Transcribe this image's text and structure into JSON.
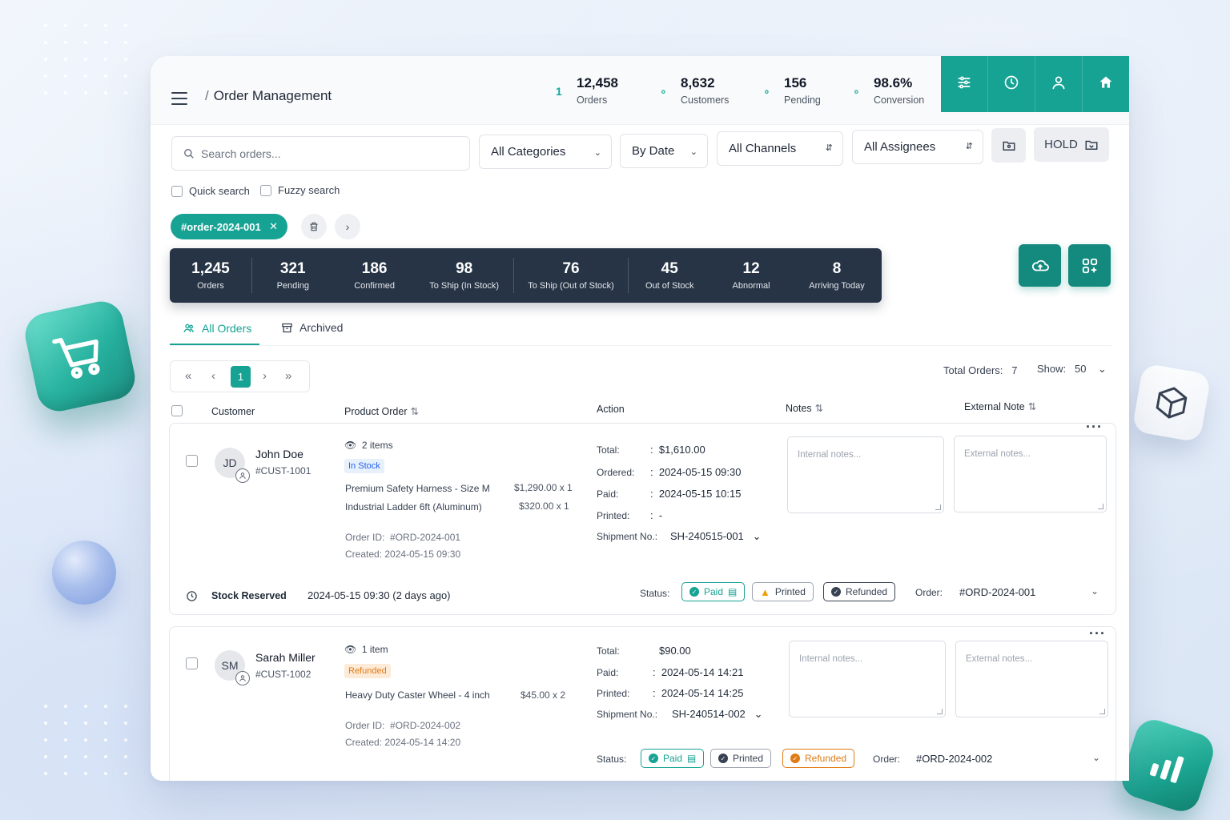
{
  "app": {
    "title": "Order Management"
  },
  "header_stats": [
    {
      "icon": "orders-icon",
      "value": "12,458",
      "label": "Orders"
    },
    {
      "icon": "customers-icon",
      "value": "8,632",
      "label": "Customers"
    },
    {
      "icon": "pending-icon",
      "value": "156",
      "label": "Pending"
    },
    {
      "icon": "conversion-icon",
      "value": "98.6%",
      "label": "Conversion"
    }
  ],
  "toolbar_icons": [
    "sliders-icon",
    "clock-icon",
    "user-icon",
    "home-icon"
  ],
  "filters": {
    "search_placeholder": "Search orders...",
    "categories": "All Categories",
    "date": "By Date",
    "channels": "All Channels",
    "assignees": "All Assignees",
    "hold_label": "HOLD",
    "quick_search": "Quick search",
    "fuzzy_search": "Fuzzy search",
    "active_tag": "#order-2024-001"
  },
  "summary": [
    {
      "value": "1,245",
      "label": "Orders"
    },
    {
      "value": "321",
      "label": "Pending"
    },
    {
      "value": "186",
      "label": "Confirmed"
    },
    {
      "value": "98",
      "label": "To Ship (In Stock)"
    },
    {
      "value": "76",
      "label": "To Ship (Out of Stock)"
    },
    {
      "value": "45",
      "label": "Out of Stock"
    },
    {
      "value": "12",
      "label": "Abnormal"
    },
    {
      "value": "8",
      "label": "Arriving Today"
    }
  ],
  "tabs": {
    "all": "All Orders",
    "archived": "Archived"
  },
  "pagination": {
    "current": "1",
    "total_label": "Total Orders:",
    "total": "7",
    "show_label": "Show:",
    "show": "50"
  },
  "columns": {
    "customer": "Customer",
    "product": "Product Order",
    "action": "Action",
    "notes": "Notes",
    "external": "External Note"
  },
  "orders": [
    {
      "initials": "JD",
      "name": "John Doe",
      "cust_id": "#CUST-1001",
      "items": "2 items",
      "stock_pill": "In Stock",
      "products": [
        {
          "name": "Premium Safety Harness - Size M",
          "price": "$1,290.00 x 1"
        },
        {
          "name": "Industrial Ladder 6ft (Aluminum)",
          "price": "$320.00 x 1"
        }
      ],
      "order_id_label": "Order ID:",
      "order_id": "#ORD-2024-001",
      "created_label": "Created:",
      "created": "2024-05-15 09:30",
      "total_label": "Total:",
      "total": "$1,610.00",
      "ordered_label": "Ordered:",
      "ordered": "2024-05-15 09:30",
      "paid_label": "Paid:",
      "paid": "2024-05-15 10:15",
      "printed_label": "Printed:",
      "printed": "-",
      "shipment_label": "Shipment No.:",
      "shipment": "SH-240515-001",
      "internal_ph": "Internal notes...",
      "external_ph": "External notes...",
      "footer_label": "Stock Reserved",
      "footer_time": "2024-05-15 09:30 (2 days ago)",
      "status_label": "Status:",
      "s_paid": "Paid",
      "s_printed": "Printed",
      "s_refunded": "Refunded",
      "order_label": "Order:",
      "order_ref": "#ORD-2024-001"
    },
    {
      "initials": "SM",
      "name": "Sarah Miller",
      "cust_id": "#CUST-1002",
      "items": "1 item",
      "stock_pill": "Refunded",
      "products": [
        {
          "name": "Heavy Duty Caster Wheel - 4 inch",
          "price": "$45.00 x 2"
        }
      ],
      "order_id_label": "Order ID:",
      "order_id": "#ORD-2024-002",
      "created_label": "Created:",
      "created": "2024-05-14 14:20",
      "total_label": "Total:",
      "total": "$90.00",
      "paid_label": "Paid:",
      "paid": "2024-05-14 14:21",
      "printed_label": "Printed:",
      "printed": "2024-05-14 14:25",
      "shipment_label": "Shipment No.:",
      "shipment": "SH-240514-002",
      "internal_ph": "Internal notes...",
      "external_ph": "External notes...",
      "status_label": "Status:",
      "s_paid": "Paid",
      "s_printed": "Printed",
      "s_refunded": "Refunded",
      "order_label": "Order:",
      "order_ref": "#ORD-2024-002"
    }
  ],
  "colors": {
    "accent": "#16a394",
    "dark_bar": "#263446",
    "warning": "#f59e0b",
    "refund": "#e07a14"
  }
}
